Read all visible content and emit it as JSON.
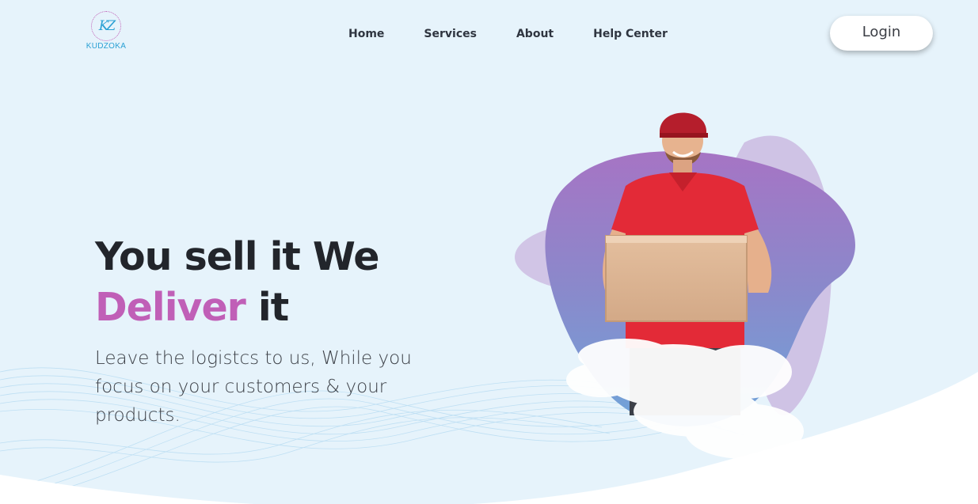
{
  "brand": {
    "monogram": "KZ",
    "name": "KUDZOKA"
  },
  "nav": {
    "home": "Home",
    "services": "Services",
    "about": "About",
    "help": "Help Center"
  },
  "login_label": "Login",
  "hero": {
    "title_line1": "You sell it We",
    "title_accent": "Deliver",
    "title_rest": " it",
    "subtitle": "Leave the logistcs to us, While you focus on your customers & your products."
  },
  "colors": {
    "background": "#e6f3fb",
    "accent": "#c05fb7",
    "text_dark": "#22252b",
    "brand_blue": "#2aa0d4"
  },
  "illustration": {
    "subject": "delivery-man-holding-box",
    "decor": [
      "purple-blob",
      "lavender-blob",
      "clouds",
      "wave-lines"
    ]
  }
}
